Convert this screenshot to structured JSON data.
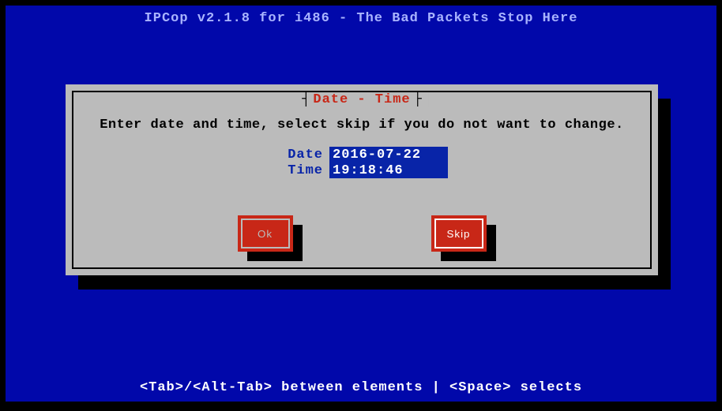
{
  "header": {
    "title": "IPCop v2.1.8 for i486 - The Bad Packets Stop Here"
  },
  "dialog": {
    "title": "Date - Time",
    "instruction": "Enter date and time, select skip if you do not want to change.",
    "fields": {
      "date": {
        "label": "Date",
        "value": "2016-07-22"
      },
      "time": {
        "label": "Time",
        "value": "19:18:46"
      }
    },
    "buttons": {
      "ok": "Ok",
      "skip": "Skip"
    }
  },
  "footer": {
    "hint": "<Tab>/<Alt-Tab> between elements   |   <Space> selects"
  }
}
